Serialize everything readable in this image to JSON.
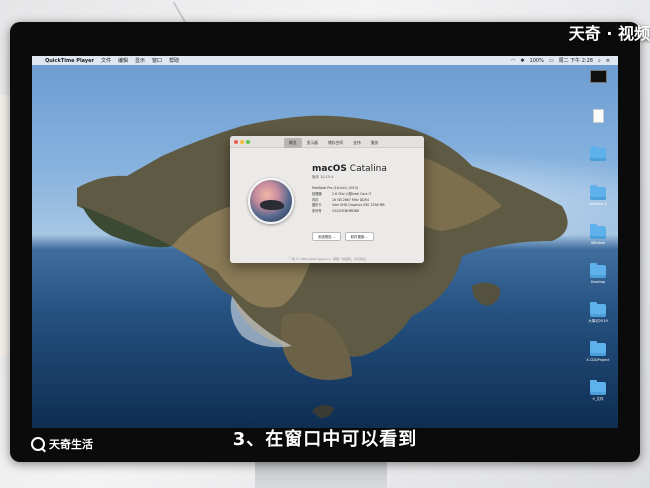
{
  "watermark": {
    "top_right": "天奇 · 视频",
    "bottom_left": "天奇生活"
  },
  "caption": "3、在窗口中可以看到",
  "menubar": {
    "app_name": "QuickTime Player",
    "items": [
      "文件",
      "编辑",
      "显示",
      "窗口",
      "帮助"
    ],
    "status": [
      "100%",
      "周二 下午 2:28"
    ]
  },
  "about_window": {
    "tabs": [
      "概览",
      "显示器",
      "储存空间",
      "支持",
      "服务"
    ],
    "os_name_bold": "macOS",
    "os_name_light": "Catalina",
    "version": "版本 10.15.4",
    "model": "MacBook Pro (16-inch, 2019)",
    "specs": [
      {
        "key": "处理器",
        "value": "2.6 GHz 六核Intel Core i7"
      },
      {
        "key": "内存",
        "value": "16 GB 2667 MHz DDR4"
      },
      {
        "key": "图形卡",
        "value": "Intel UHD Graphics 630 1536 MB"
      },
      {
        "key": "序列号",
        "value": "C02ZH1NHMD6R"
      }
    ],
    "buttons": [
      "系统报告...",
      "软件更新..."
    ],
    "copyright": "™ 和 © 1983-2020 Apple Inc. 保留一切权利。许可协议"
  },
  "desktop_icons": [
    {
      "type": "thumb",
      "label": ""
    },
    {
      "type": "doc",
      "label": ""
    },
    {
      "type": "folder",
      "label": ""
    },
    {
      "type": "folder",
      "label": "Window 2"
    },
    {
      "type": "folder",
      "label": "Window"
    },
    {
      "type": "folder",
      "label": "Desktop"
    },
    {
      "type": "folder",
      "label": "大事记2019"
    },
    {
      "type": "folder",
      "label": "X.CDDProject"
    },
    {
      "type": "folder",
      "label": "9_文件"
    }
  ],
  "colors": {
    "wallpaper_sky": "#86b2de",
    "wallpaper_sea": "#1f4a78",
    "caption": "#ffffff"
  }
}
